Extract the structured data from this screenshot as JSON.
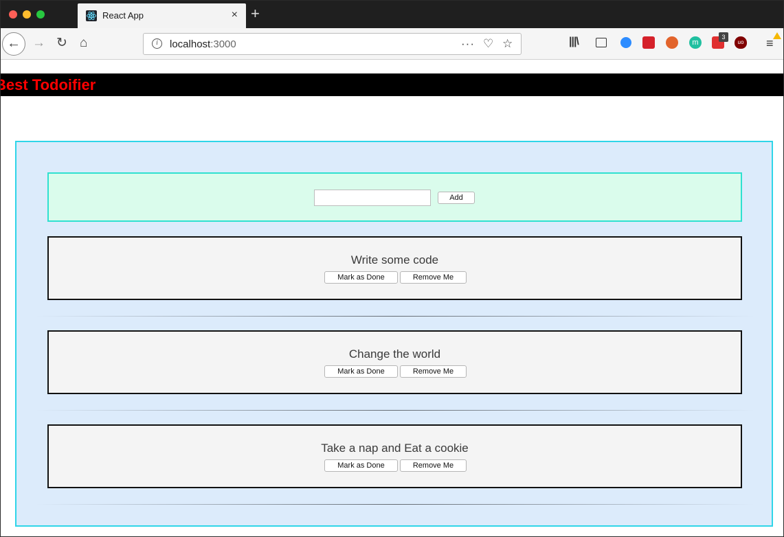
{
  "browser": {
    "tab_title": "React App",
    "tab_close": "×",
    "new_tab": "+",
    "url_host": "localhost",
    "url_port": ":3000",
    "more_actions": "···",
    "todo_badge_count": "3",
    "m_ext_letter": "m",
    "ublock_label": "uo",
    "icons": {
      "back": "back-arrow-icon",
      "forward": "forward-arrow-icon",
      "reload": "reload-icon",
      "home": "home-icon",
      "info": "info-icon",
      "pocket": "pocket-icon",
      "bookmark": "star-icon",
      "library": "library-icon",
      "sidebar": "sidebar-icon",
      "menu": "hamburger-menu-icon"
    }
  },
  "app": {
    "title": "Best Todoifier",
    "add_form": {
      "input_value": "",
      "add_label": "Add"
    },
    "todos": [
      {
        "text": "Write some code",
        "done_label": "Mark as Done",
        "remove_label": "Remove Me"
      },
      {
        "text": "Change the world",
        "done_label": "Mark as Done",
        "remove_label": "Remove Me"
      },
      {
        "text": "Take a nap and Eat a cookie",
        "done_label": "Mark as Done",
        "remove_label": "Remove Me"
      }
    ]
  },
  "colors": {
    "header_bg": "#000000",
    "title_red": "#ff0000",
    "container_bg": "#dcebfb",
    "container_border": "#2fd5e8",
    "form_bg": "#dafcec",
    "card_bg": "#f4f4f4"
  }
}
